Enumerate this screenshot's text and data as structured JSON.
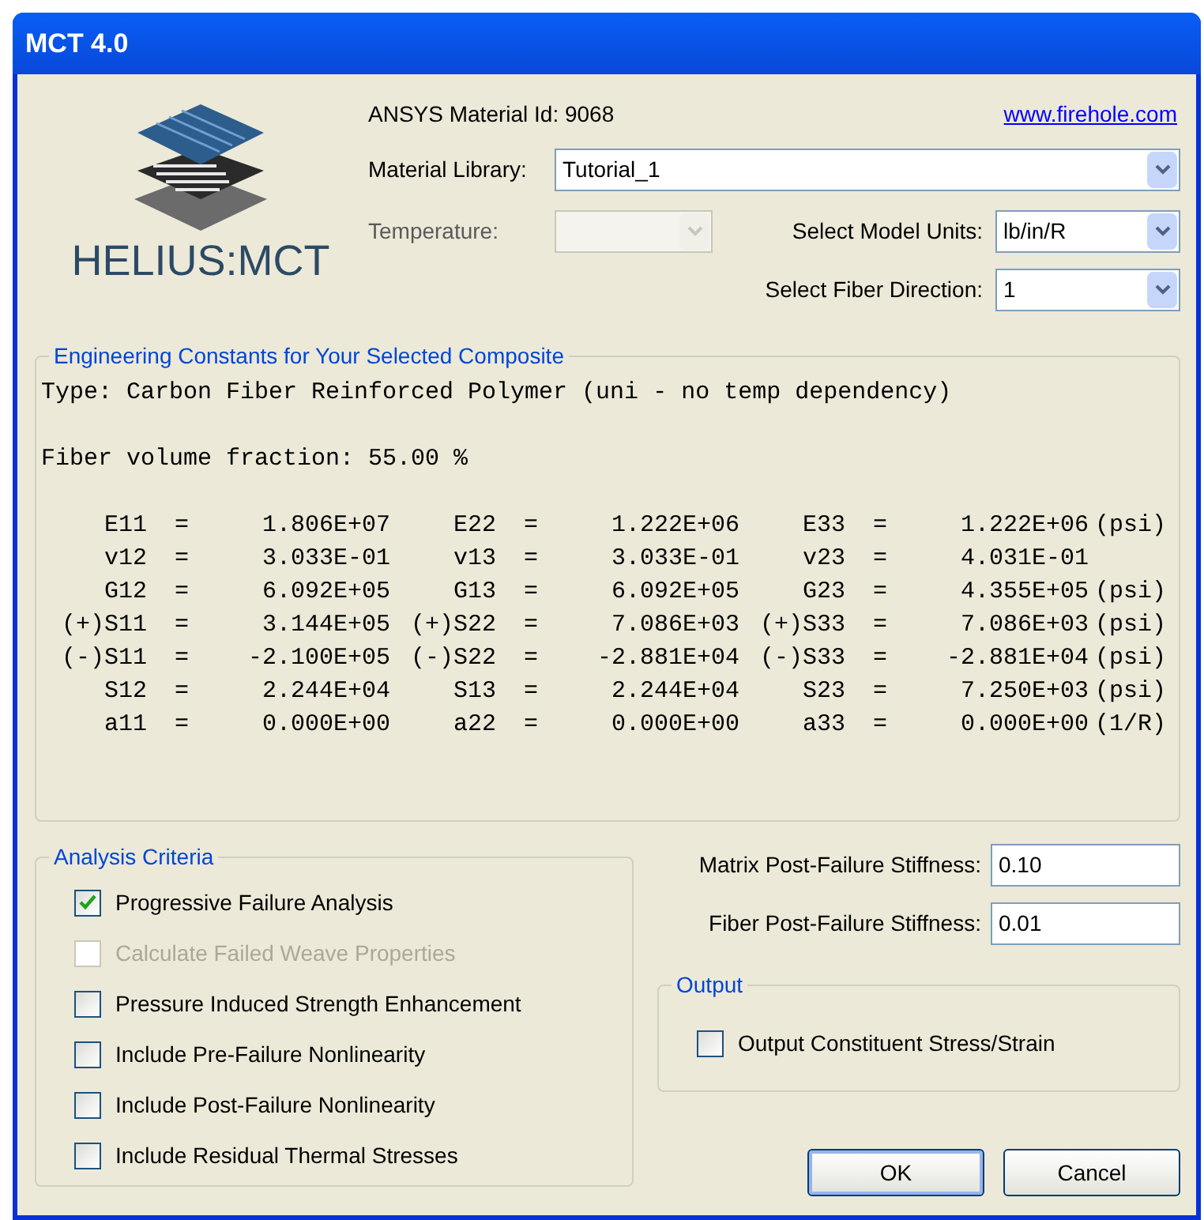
{
  "window": {
    "title": "MCT 4.0"
  },
  "logo": {
    "text": "HELIUS:MCT"
  },
  "material_id": "ANSYS Material Id: 9068",
  "link": "www.firehole.com",
  "material_library": {
    "label": "Material Library:",
    "value": "Tutorial_1",
    "disabled": false
  },
  "temperature": {
    "label": "Temperature:",
    "disabled": true
  },
  "model_units": {
    "label": "Select Model Units:",
    "value": "lb/in/R",
    "disabled": false
  },
  "fiber_direction": {
    "label": "Select Fiber Direction:",
    "value": "1",
    "disabled": false
  },
  "constants": {
    "title": "Engineering Constants for Your Selected Composite",
    "type_line": "Type: Carbon Fiber Reinforced Polymer (uni - no temp dependency)",
    "fraction_line": "Fiber volume fraction: 55.00 %",
    "rows": [
      {
        "cells": [
          {
            "name": "E11",
            "eq": "=",
            "value": "1.806E+07"
          },
          {
            "name": "E22",
            "eq": "=",
            "value": "1.222E+06"
          },
          {
            "name": "E33",
            "eq": "=",
            "value": "1.222E+06"
          }
        ],
        "unit": "(psi)"
      },
      {
        "cells": [
          {
            "name": "v12",
            "eq": "=",
            "value": "3.033E-01"
          },
          {
            "name": "v13",
            "eq": "=",
            "value": "3.033E-01"
          },
          {
            "name": "v23",
            "eq": "=",
            "value": "4.031E-01"
          }
        ]
      },
      {
        "cells": [
          {
            "name": "G12",
            "eq": "=",
            "value": "6.092E+05"
          },
          {
            "name": "G13",
            "eq": "=",
            "value": "6.092E+05"
          },
          {
            "name": "G23",
            "eq": "=",
            "value": "4.355E+05"
          }
        ],
        "unit": "(psi)"
      },
      {
        "cells": [
          {
            "name": "(+)S11",
            "eq": "=",
            "value": "3.144E+05"
          },
          {
            "name": "(+)S22",
            "eq": "=",
            "value": "7.086E+03"
          },
          {
            "name": "(+)S33",
            "eq": "=",
            "value": "7.086E+03"
          }
        ],
        "unit": "(psi)"
      },
      {
        "cells": [
          {
            "name": "(-)S11",
            "eq": "=",
            "value": "-2.100E+05"
          },
          {
            "name": "(-)S22",
            "eq": "=",
            "value": "-2.881E+04"
          },
          {
            "name": "(-)S33",
            "eq": "=",
            "value": "-2.881E+04"
          }
        ],
        "unit": "(psi)"
      },
      {
        "cells": [
          {
            "name": "S12",
            "eq": "=",
            "value": "2.244E+04"
          },
          {
            "name": "S13",
            "eq": "=",
            "value": "2.244E+04"
          },
          {
            "name": "S23",
            "eq": "=",
            "value": "7.250E+03"
          }
        ],
        "unit": "(psi)"
      },
      {
        "cells": [
          {
            "name": "a11",
            "eq": "=",
            "value": "0.000E+00"
          },
          {
            "name": "a22",
            "eq": "=",
            "value": "0.000E+00"
          },
          {
            "name": "a33",
            "eq": "=",
            "value": "0.000E+00"
          }
        ],
        "unit": "(1/R)"
      }
    ]
  },
  "analysis_criteria": {
    "title": "Analysis Criteria",
    "items": [
      {
        "label": "Progressive Failure Analysis",
        "checked": true,
        "disabled": false
      },
      {
        "label": "Calculate Failed Weave Properties",
        "checked": false,
        "disabled": true
      },
      {
        "label": "Pressure Induced Strength Enhancement",
        "checked": false,
        "disabled": false
      },
      {
        "label": "Include Pre-Failure Nonlinearity",
        "checked": false,
        "disabled": false
      },
      {
        "label": "Include Post-Failure Nonlinearity",
        "checked": false,
        "disabled": false
      },
      {
        "label": "Include Residual Thermal Stresses",
        "checked": false,
        "disabled": false
      }
    ]
  },
  "stiffness_fields": [
    {
      "label": "Matrix Post-Failure Stiffness:",
      "value": "0.10"
    },
    {
      "label": "Fiber Post-Failure Stiffness:",
      "value": "0.01"
    }
  ],
  "output": {
    "title": "Output",
    "items": [
      {
        "label": "Output Constituent Stress/Strain",
        "checked": false,
        "disabled": false
      }
    ]
  },
  "buttons": [
    {
      "label": "OK",
      "default": true
    },
    {
      "label": "Cancel",
      "default": false
    }
  ]
}
